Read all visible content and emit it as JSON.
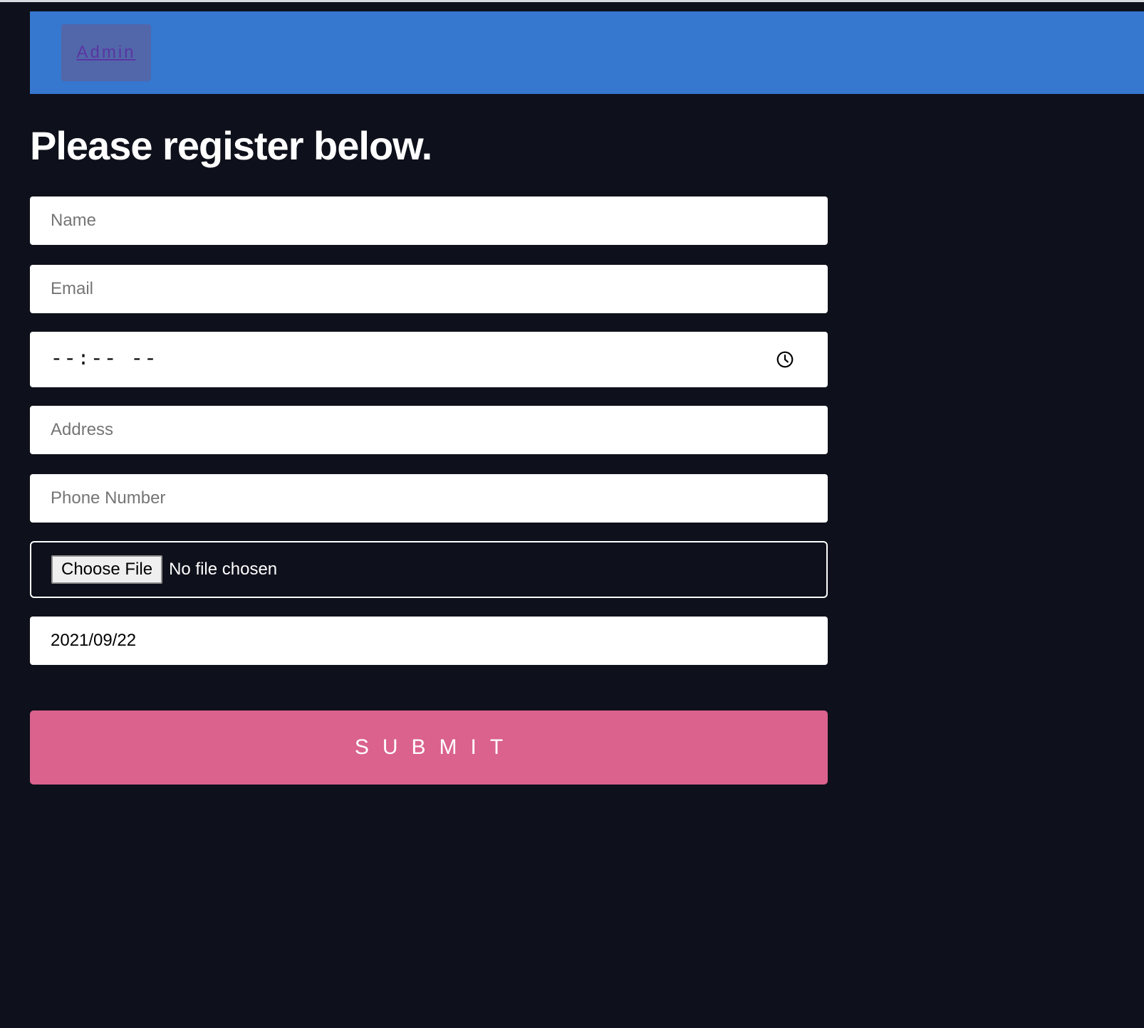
{
  "colors": {
    "navbar": "#3677cf",
    "admin_button": "#5267a9",
    "background": "#0e101b",
    "submit": "#da628d"
  },
  "nav": {
    "admin_label": "Admin"
  },
  "page": {
    "title": "Please register below."
  },
  "form": {
    "name_placeholder": "Name",
    "email_placeholder": "Email",
    "time_value": "--:-- --",
    "address_placeholder": "Address",
    "phone_placeholder": "Phone Number",
    "file_button_label": "Choose File",
    "file_status": "No file chosen",
    "date_value": "2021/09/22",
    "submit_label": "SUBMIT"
  },
  "icons": {
    "time": "clock-icon"
  }
}
